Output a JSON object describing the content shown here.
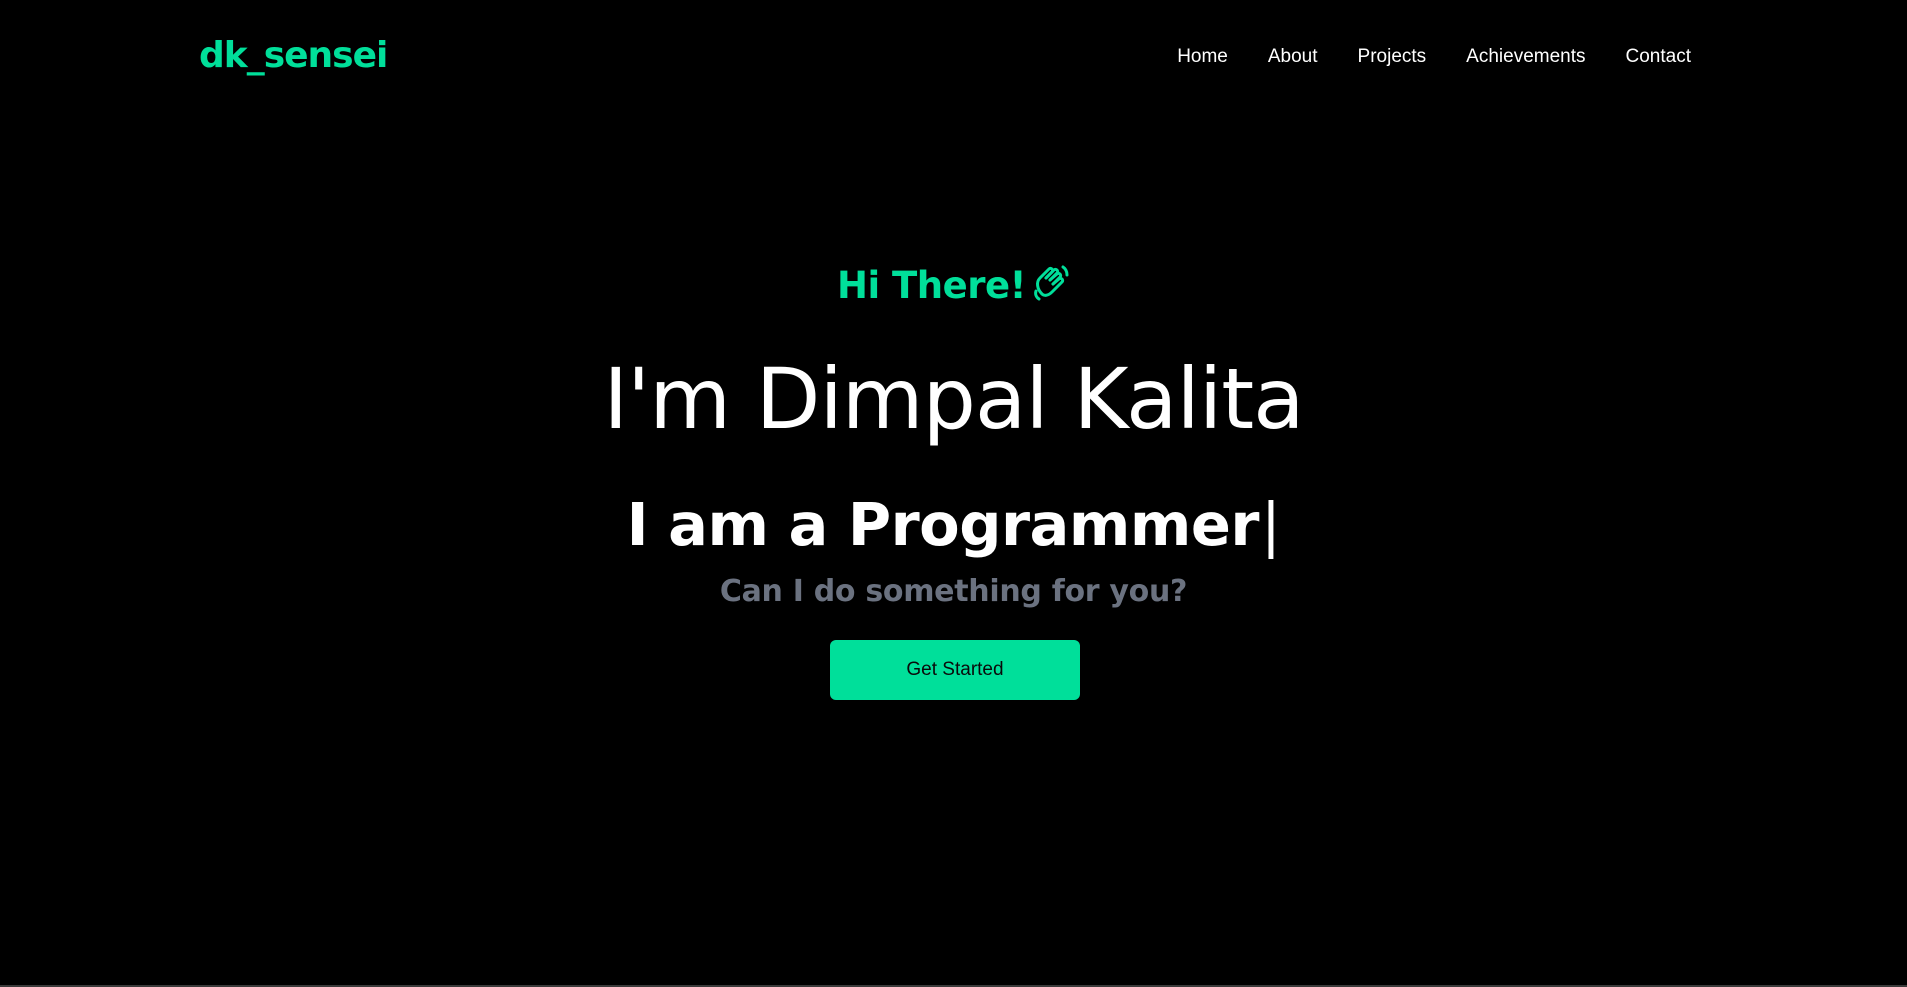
{
  "theme": {
    "background": "#000000",
    "accent": "#00df9a",
    "text": "#ffffff",
    "muted": "#6b7280"
  },
  "header": {
    "logo": "dk_sensei",
    "nav": [
      {
        "label": "Home"
      },
      {
        "label": "About"
      },
      {
        "label": "Projects"
      },
      {
        "label": "Achievements"
      },
      {
        "label": "Contact"
      }
    ]
  },
  "hero": {
    "greeting": "Hi There!",
    "greeting_icon": "wave-hand-icon",
    "name": "I'm Dimpal Kalita",
    "typing_prefix": "I am a ",
    "typing_word": "Programmer",
    "typing_cursor": "|",
    "subtitle": "Can I do something for you?",
    "cta_label": "Get Started"
  }
}
